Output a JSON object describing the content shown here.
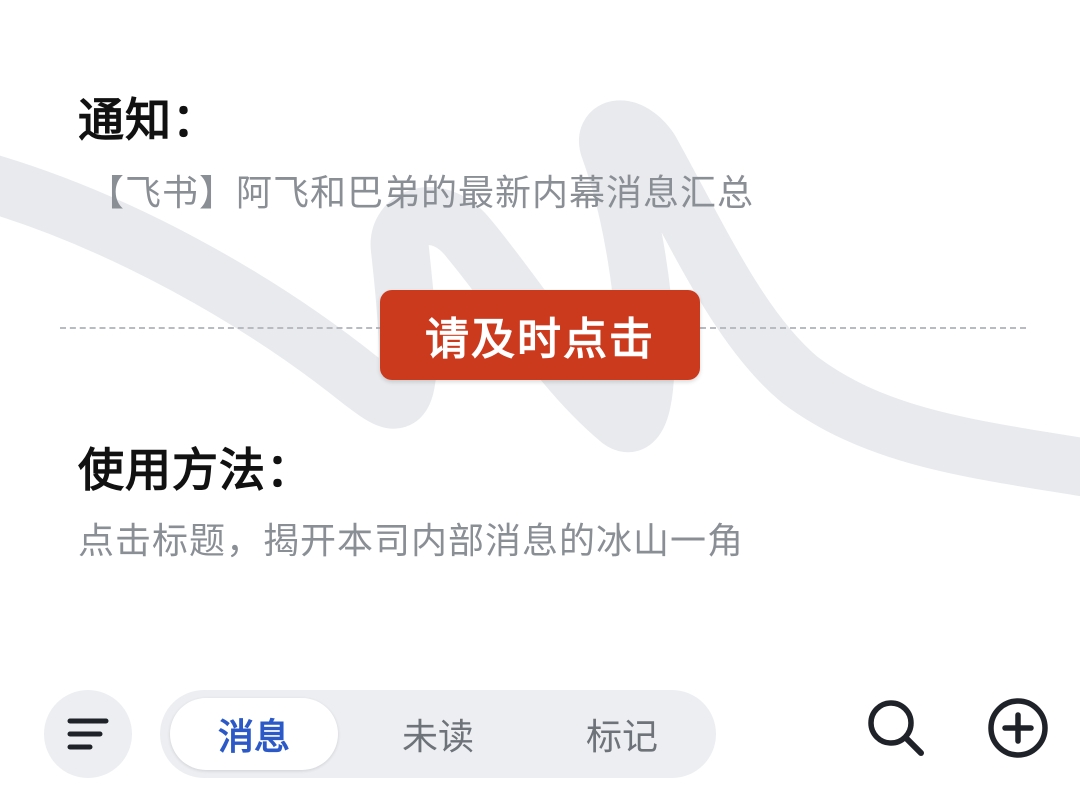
{
  "notice": {
    "heading": "通知：",
    "text": "【飞书】阿飞和巴弟的最新内幕消息汇总"
  },
  "cta": {
    "label": "请及时点击",
    "color": "#cc3a1e"
  },
  "usage": {
    "heading": "使用方法：",
    "text": "点击标题，揭开本司内部消息的冰山一角"
  },
  "bottom_bar": {
    "menu_icon": "menu-icon",
    "tabs": [
      {
        "label": "消息",
        "active": true
      },
      {
        "label": "未读",
        "active": false
      },
      {
        "label": "标记",
        "active": false
      }
    ],
    "search_icon": "search-icon",
    "add_icon": "plus-circle-icon",
    "accent_color": "#2b5ac8"
  }
}
